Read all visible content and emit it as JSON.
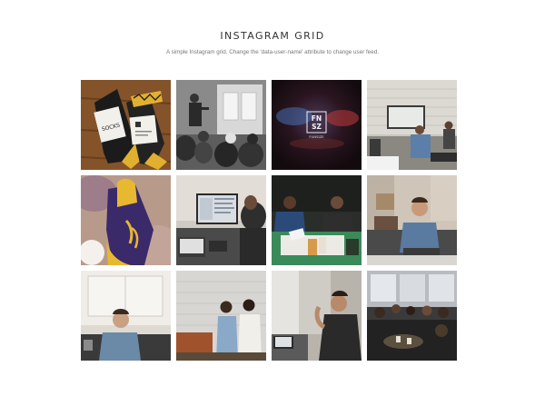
{
  "header": {
    "title": "INSTAGRAM GRID",
    "subtitle": "A simple Instagram grid. Change the 'data-user-name' attribute to change user feed."
  },
  "tiles": [
    {
      "name": "socks-photo",
      "socks_label": "SOCKS"
    },
    {
      "name": "presentation-bw-photo"
    },
    {
      "name": "fnsz-logo-photo",
      "logo_line1": "FN",
      "logo_line2": "SZ",
      "logo_caption": "FUNSIZE"
    },
    {
      "name": "office-screen-photo"
    },
    {
      "name": "sock-closeup-photo"
    },
    {
      "name": "monitor-desk-photo"
    },
    {
      "name": "meeting-table-photo"
    },
    {
      "name": "man-sofa-photo"
    },
    {
      "name": "man-window-photo"
    },
    {
      "name": "two-people-talking-photo"
    },
    {
      "name": "man-gesturing-photo"
    },
    {
      "name": "team-group-photo"
    }
  ]
}
